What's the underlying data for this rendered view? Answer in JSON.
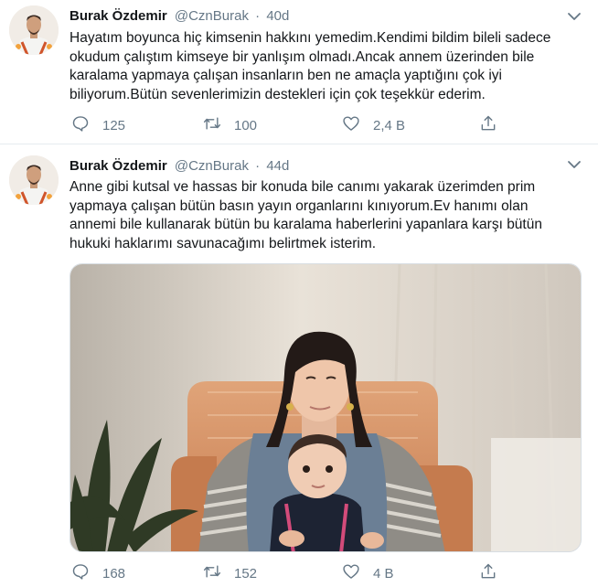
{
  "tweets": [
    {
      "author_name": "Burak Özdemir",
      "handle": "@CznBurak",
      "separator": "·",
      "time": "40d",
      "text_lines": [
        "Hayatım boyunca hiç kimsenin hakkını yemedim.Kendimi bildim bileli sadece",
        "okudum çalıştım kimseye bir yanlışım olmadı.Ancak annem üzerinden bile",
        "karalama yapmaya çalışan insanların ben ne amaçla yaptığını çok iyi",
        "biliyorum.Bütün sevenlerimizin destekleri için çok teşekkür ederim."
      ],
      "replies": "125",
      "retweets": "100",
      "likes": "2,4 B"
    },
    {
      "author_name": "Burak Özdemir",
      "handle": "@CznBurak",
      "separator": "·",
      "time": "44d",
      "text_lines": [
        "Anne gibi kutsal ve hassas bir konuda bile canımı yakarak üzerimden prim",
        "yapmaya çalışan bütün basın yayın organlarını kınıyorum.Ev hanımı olan",
        "annemi bile kullanarak bütün bu karalama haberlerini yapanlara karşı bütün",
        "hukuki haklarımı savunacağımı belirtmek isterim."
      ],
      "replies": "168",
      "retweets": "152",
      "likes": "4 B"
    }
  ],
  "icons": {
    "reply": "reply-icon",
    "retweet": "retweet-icon",
    "like": "heart-icon",
    "share": "share-icon",
    "more": "chevron-down-icon"
  },
  "colors": {
    "name": "#14171a",
    "secondary": "#657786",
    "divider": "#e6ecf0"
  }
}
